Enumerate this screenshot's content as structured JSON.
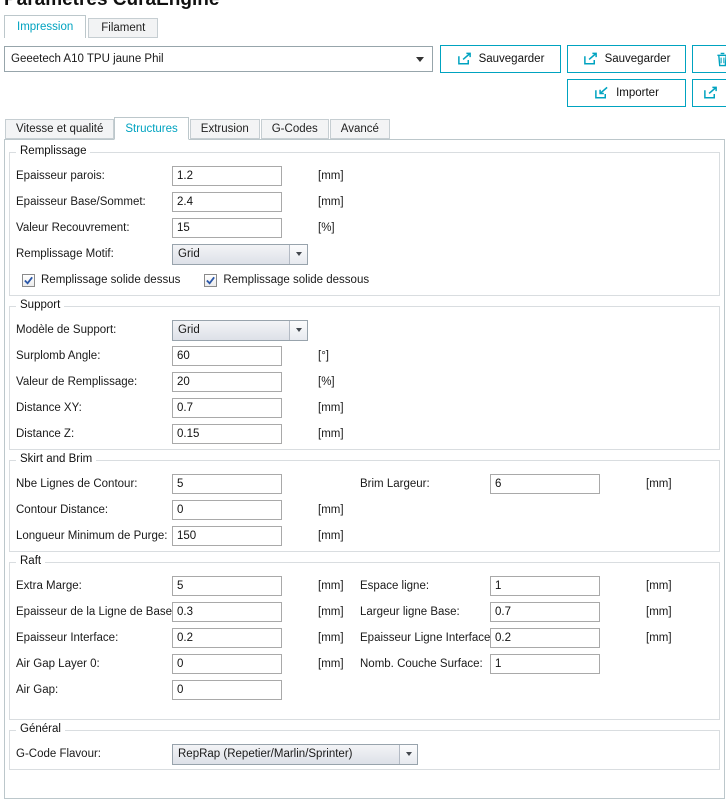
{
  "colors": {
    "accent": "#00a3c0"
  },
  "header": {
    "title": "Paramètres CuraEngine"
  },
  "main_tabs": {
    "impression": "Impression",
    "filament": "Filament"
  },
  "profile_select": {
    "value": "Geeetech A10 TPU jaune Phil"
  },
  "toolbar": {
    "save": "Sauvegarder",
    "save_as": "Sauvegarder",
    "import": "Importer"
  },
  "settings_tabs": {
    "speed": "Vitesse et qualité",
    "structures": "Structures",
    "extrusion": "Extrusion",
    "gcodes": "G-Codes",
    "advanced": "Avancé"
  },
  "infill": {
    "title": "Remplissage",
    "rows": [
      {
        "label": "Epaisseur parois:",
        "value": "1.2",
        "unit": "[mm]"
      },
      {
        "label": "Epaisseur Base/Sommet:",
        "value": "2.4",
        "unit": "[mm]"
      },
      {
        "label": "Valeur Recouvrement:",
        "value": "15",
        "unit": "[%]"
      }
    ],
    "pattern_label": "Remplissage Motif:",
    "pattern_value": "Grid",
    "checks": [
      {
        "label": "Remplissage solide dessus",
        "checked": true
      },
      {
        "label": "Remplissage solide dessous",
        "checked": true
      }
    ]
  },
  "support": {
    "title": "Support",
    "pattern_label": "Modèle de Support:",
    "pattern_value": "Grid",
    "rows": [
      {
        "label": "Surplomb Angle:",
        "value": "60",
        "unit": "[°]"
      },
      {
        "label": "Valeur de Remplissage:",
        "value": "20",
        "unit": "[%]"
      },
      {
        "label": "Distance XY:",
        "value": "0.7",
        "unit": "[mm]"
      },
      {
        "label": "Distance Z:",
        "value": "0.15",
        "unit": "[mm]"
      }
    ]
  },
  "skirt": {
    "title": "Skirt and Brim",
    "rows": [
      {
        "label": "Nbe Lignes de Contour:",
        "value": "5",
        "unit": "",
        "label2": "Brim Largeur:",
        "value2": "6",
        "unit2": "[mm]"
      },
      {
        "label": "Contour Distance:",
        "value": "0",
        "unit": "[mm]"
      },
      {
        "label": "Longueur Minimum de Purge:",
        "value": "150",
        "unit": "[mm]"
      }
    ]
  },
  "raft": {
    "title": "Raft",
    "rows": [
      {
        "label": "Extra Marge:",
        "value": "5",
        "unit": "[mm]",
        "label2": "Espace ligne:",
        "value2": "1",
        "unit2": "[mm]"
      },
      {
        "label": "Épaisseur de la Ligne de Base:",
        "value": "0.3",
        "unit": "[mm]",
        "label2": "Largeur ligne Base:",
        "value2": "0.7",
        "unit2": "[mm]"
      },
      {
        "label": "Epaisseur Interface:",
        "value": "0.2",
        "unit": "[mm]",
        "label2": "Epaisseur Ligne Interface:",
        "value2": "0.2",
        "unit2": "[mm]"
      },
      {
        "label": "Air Gap Layer 0:",
        "value": "0",
        "unit": "[mm]",
        "label2": "Nomb. Couche Surface:",
        "value2": "1",
        "unit2": ""
      },
      {
        "label": "Air Gap:",
        "value": "0",
        "unit": ""
      }
    ]
  },
  "general": {
    "title": "Général",
    "flavour_label": "G-Code Flavour:",
    "flavour_value": "RepRap (Repetier/Marlin/Sprinter)"
  }
}
